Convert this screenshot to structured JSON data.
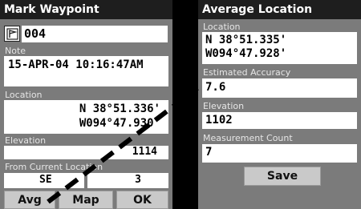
{
  "mark_waypoint": {
    "title": "Mark Waypoint",
    "name": "004",
    "note_label": "Note",
    "note": "15-APR-04 10:16:47AM",
    "location_label": "Location",
    "lat": "N  38°51.336'",
    "lon": "W094°47.930'",
    "elevation_label": "Elevation",
    "elevation": "1114",
    "from_label": "From Current Location",
    "bearing": "SE",
    "distance": "3",
    "buttons": {
      "avg": "Avg",
      "map": "Map",
      "ok": "OK"
    }
  },
  "average_location": {
    "title": "Average Location",
    "location_label": "Location",
    "lat": "N  38°51.335'",
    "lon": "W094°47.928'",
    "accuracy_label": "Estimated Accuracy",
    "accuracy": "7.6",
    "elevation_label": "Elevation",
    "elevation": "1102",
    "count_label": "Measurement Count",
    "count": "7",
    "save": "Save"
  },
  "colors": {
    "panel": "#7b7b7b",
    "titlebar": "#1e1e1e",
    "field": "#ffffff",
    "background": "#000000"
  },
  "icons": [
    "waypoint-flag-icon"
  ]
}
